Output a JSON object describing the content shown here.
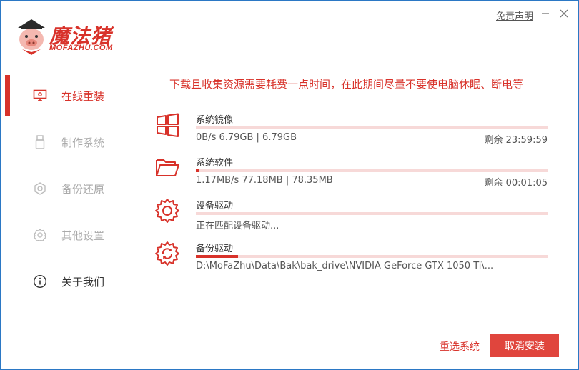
{
  "brand": {
    "name": "魔法猪",
    "subtitle": "MOFAZHU.COM",
    "color": "#d8322a"
  },
  "header": {
    "disclaimer": "免责声明",
    "minimize_icon": "minimize-icon",
    "close_icon": "close-icon"
  },
  "sidebar": {
    "items": [
      {
        "label": "在线重装",
        "icon": "monitor-icon",
        "state": "active"
      },
      {
        "label": "制作系统",
        "icon": "usb-icon",
        "state": "disabled"
      },
      {
        "label": "备份还原",
        "icon": "backup-icon",
        "state": "disabled"
      },
      {
        "label": "其他设置",
        "icon": "gear-icon",
        "state": "disabled"
      },
      {
        "label": "关于我们",
        "icon": "info-icon",
        "state": "normal"
      }
    ]
  },
  "main": {
    "notice": "下载且收集资源需要耗费一点时间，在此期间尽量不要使电脑休眠、断电等",
    "tasks": [
      {
        "name": "系统镜像",
        "detail": "0B/s 6.79GB | 6.79GB",
        "remain": "剩余 23:59:59",
        "progress": 0.0,
        "icon": "windows-icon"
      },
      {
        "name": "系统软件",
        "detail": "1.17MB/s 77.18MB | 78.35MB",
        "remain": "剩余 00:01:05",
        "progress": 0.008,
        "icon": "folder-icon"
      },
      {
        "name": "设备驱动",
        "detail": "正在匹配设备驱动...",
        "remain": "",
        "progress": 0.0,
        "icon": "device-driver-icon"
      },
      {
        "name": "备份驱动",
        "detail": "D:\\MoFaZhu\\Data\\Bak\\bak_drive\\NVIDIA GeForce GTX 1050 Ti\\...",
        "remain": "",
        "progress": 0.12,
        "icon": "backup-driver-icon"
      }
    ]
  },
  "footer": {
    "reselect_label": "重选系统",
    "cancel_label": "取消安装"
  }
}
